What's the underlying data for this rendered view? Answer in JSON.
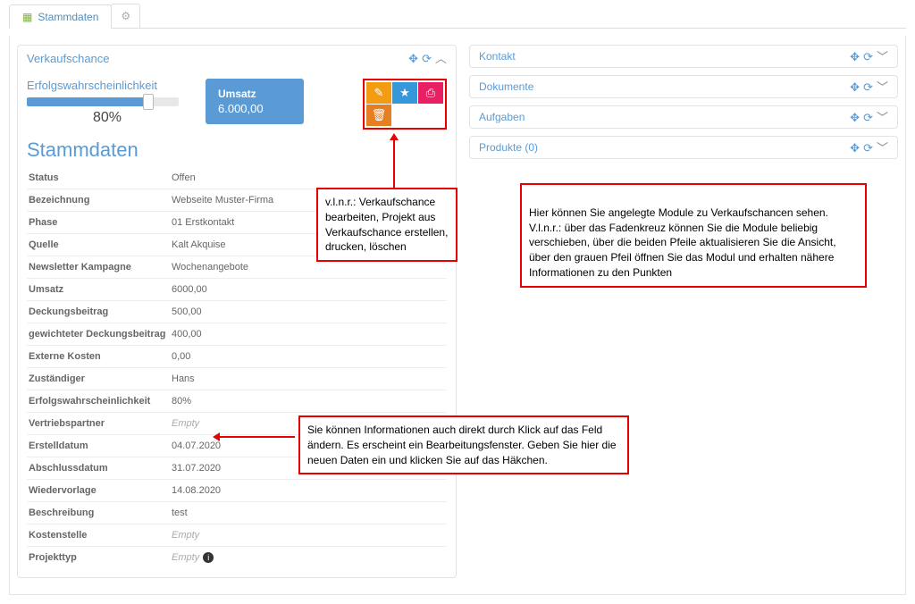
{
  "tabs": {
    "main": "Stammdaten"
  },
  "panel_main": {
    "title": "Verkaufschance"
  },
  "gauge": {
    "label": "Erfolgswahrscheinlichkeit",
    "value": "80%"
  },
  "umsatz": {
    "label": "Umsatz",
    "value": "6.000,00"
  },
  "section_title": "Stammdaten",
  "rows": [
    {
      "k": "Status",
      "v": "Offen"
    },
    {
      "k": "Bezeichnung",
      "v": "Webseite Muster-Firma"
    },
    {
      "k": "Phase",
      "v": "01 Erstkontakt"
    },
    {
      "k": "Quelle",
      "v": "Kalt Akquise"
    },
    {
      "k": "Newsletter Kampagne",
      "v": "Wochenangebote"
    },
    {
      "k": "Umsatz",
      "v": "6000,00"
    },
    {
      "k": "Deckungsbeitrag",
      "v": "500,00"
    },
    {
      "k": "gewichteter Deckungsbeitrag",
      "v": "400,00"
    },
    {
      "k": "Externe Kosten",
      "v": "0,00"
    },
    {
      "k": "Zuständiger",
      "v": "Hans"
    },
    {
      "k": "Erfolgswahrscheinlichkeit",
      "v": "80%"
    },
    {
      "k": "Vertriebspartner",
      "v": "Empty",
      "empty": true
    },
    {
      "k": "Erstelldatum",
      "v": "04.07.2020"
    },
    {
      "k": "Abschlussdatum",
      "v": "31.07.2020"
    },
    {
      "k": "Wiedervorlage",
      "v": "14.08.2020"
    },
    {
      "k": "Beschreibung",
      "v": "test"
    },
    {
      "k": "Kostenstelle",
      "v": "Empty",
      "empty": true
    },
    {
      "k": "Projekttyp",
      "v": "Empty",
      "empty": true,
      "info": true
    }
  ],
  "side_panels": [
    {
      "title": "Kontakt"
    },
    {
      "title": "Dokumente"
    },
    {
      "title": "Aufgaben"
    },
    {
      "title": "Produkte (0)"
    }
  ],
  "annotations": {
    "buttons": "v.l.n.r.: Verkaufschance bearbeiten, Projekt aus Verkaufschance erstellen, drucken, löschen",
    "modules": "Hier können Sie angelegte Module zu Verkaufschancen sehen.\nV.l.n.r.: über das Fadenkreuz können Sie die Module beliebig verschieben, über die beiden Pfeile aktualisieren Sie die Ansicht, über den grauen Pfeil öffnen Sie das Modul und erhalten nähere Informationen zu den Punkten",
    "edit": "Sie können Informationen auch direkt durch Klick auf das Feld ändern. Es erscheint ein Bearbeitungsfenster. Geben Sie hier die neuen Daten ein und klicken Sie auf das Häkchen."
  }
}
